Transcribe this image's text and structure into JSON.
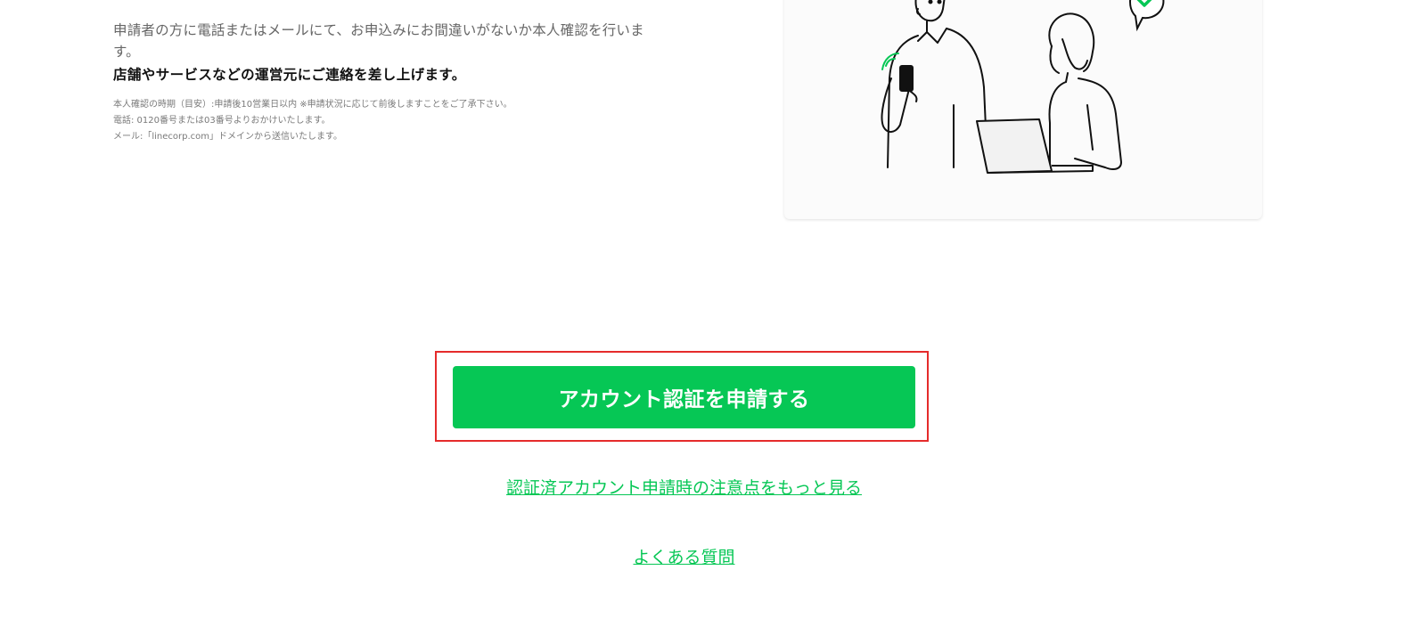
{
  "description": {
    "line1": "申請者の方に電話またはメールにて、お申込みにお間違いがないか本人確認を行いま",
    "line2": "す。",
    "bold": "店舗やサービスなどの運営元にご連絡を差し上げます。",
    "notes": [
      "本人確認の時期（目安）:申請後10営業日以内 ※申請状況に応じて前後しますことをご了承下さい。",
      "電話: 0120番号または03番号よりおかけいたします。",
      "メール:「linecorp.com」ドメインから送信いたします。"
    ]
  },
  "illustration": {
    "name": "verification-illustration",
    "accent_color": "#06c755"
  },
  "actions": {
    "primary_label": "アカウント認証を申請する",
    "more_link": "認証済アカウント申請時の注意点をもっと見る",
    "faq_link": "よくある質問"
  },
  "colors": {
    "brand_green": "#06c755",
    "highlight_red": "#e52b2b"
  }
}
